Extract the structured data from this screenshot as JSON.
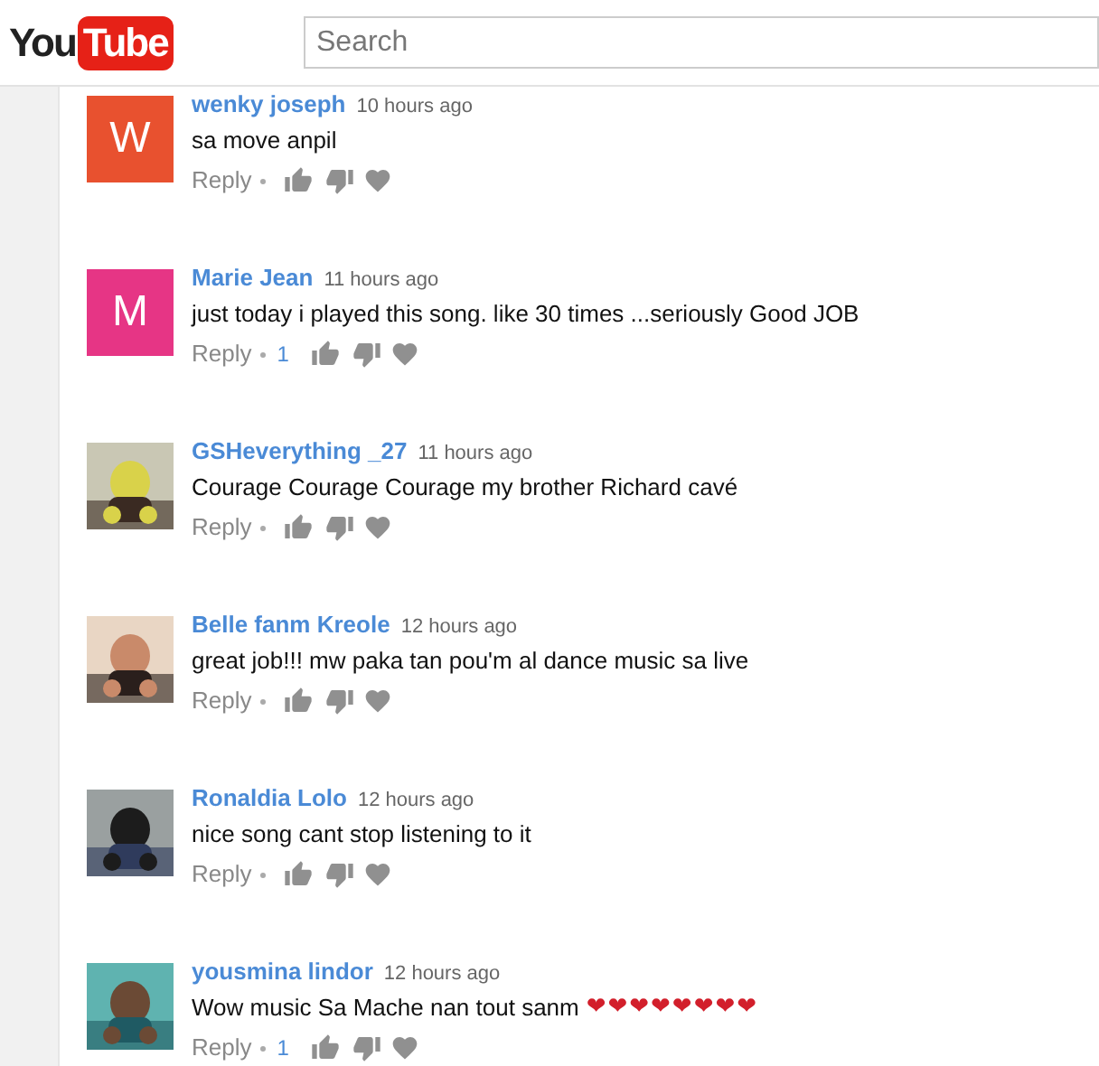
{
  "header": {
    "logo": {
      "you": "You",
      "tube": "Tube"
    },
    "search": {
      "placeholder": "Search"
    }
  },
  "comments": [
    {
      "author": "wenky joseph",
      "time": "10 hours ago",
      "text": "sa move anpil",
      "avatar": {
        "kind": "letter",
        "letter": "W",
        "color": "#e8512f"
      },
      "reply": "Reply"
    },
    {
      "author": "Marie Jean",
      "time": "11 hours ago",
      "text": "just today i played this song. like 30 times ...seriously Good JOB",
      "avatar": {
        "kind": "letter",
        "letter": "M",
        "color": "#e63585"
      },
      "reply": "Reply",
      "likes": "1"
    },
    {
      "author": "GSHeverything _27",
      "time": "11 hours ago",
      "text": "Courage Courage Courage my brother Richard cavé",
      "reply": "Reply"
    },
    {
      "author": "Belle fanm Kreole",
      "time": "12 hours ago",
      "text": "great job!!! mw paka tan pou'm al dance music sa live",
      "reply": "Reply"
    },
    {
      "author": "Ronaldia Lolo",
      "time": "12 hours ago",
      "text": "nice song cant stop listening to it",
      "reply": "Reply"
    },
    {
      "author": "yousmina lindor",
      "time": "12 hours ago",
      "text": "Wow music Sa Mache nan tout sanm",
      "emoji": "❤❤❤❤❤❤❤❤",
      "reply": "Reply",
      "likes": "1"
    }
  ]
}
